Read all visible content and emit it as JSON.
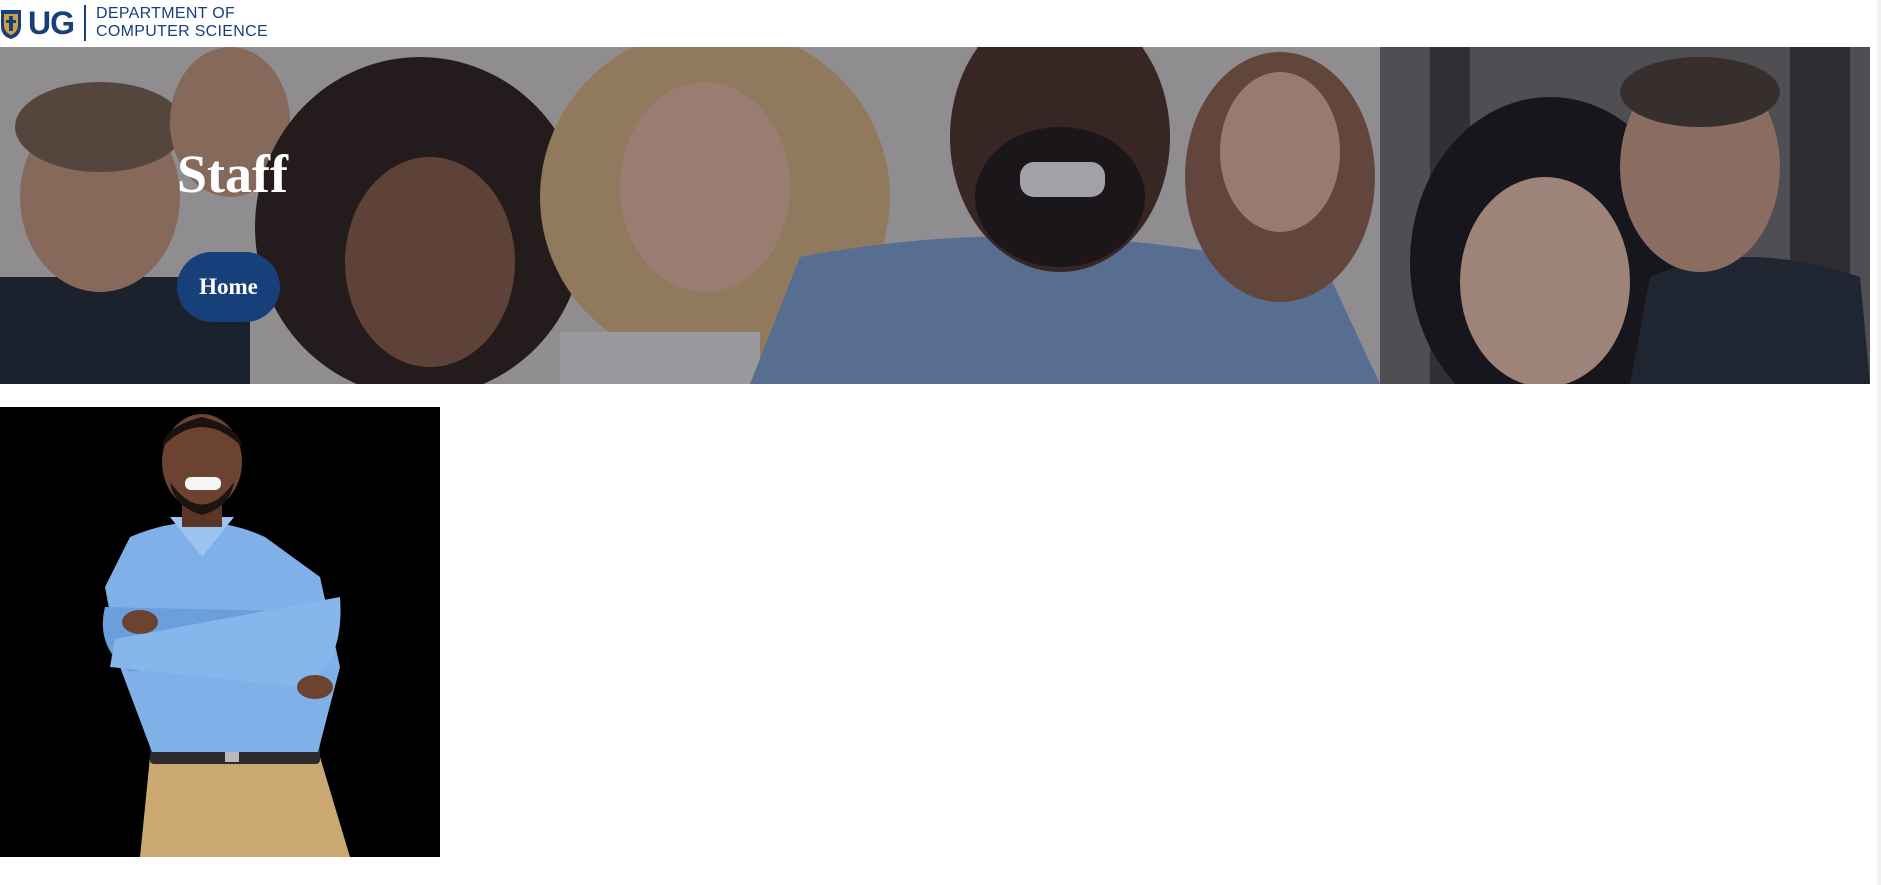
{
  "header": {
    "logo": {
      "icon": "university-crest-icon",
      "abbr": "UG",
      "line1": "DEPARTMENT OF",
      "line2": "COMPUTER SCIENCE"
    }
  },
  "hero": {
    "title": "Staff",
    "home_button": "Home"
  },
  "staff": {
    "photo": "staff-member-photo"
  },
  "colors": {
    "brand": "#173f7a",
    "photo_bg": "#000000"
  }
}
